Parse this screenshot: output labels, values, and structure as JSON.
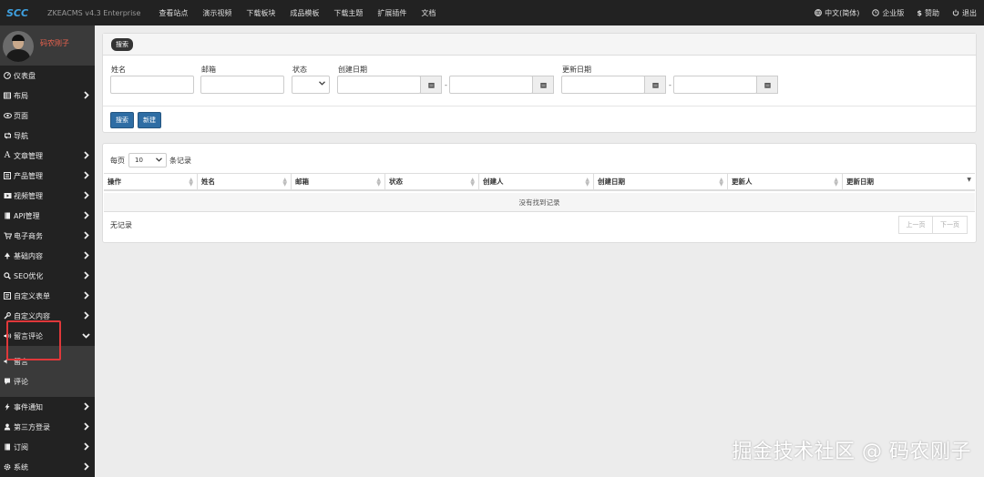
{
  "header": {
    "logo": "ZKEACMS-logo",
    "brand": "ZKEACMS v4.3 Enterprise",
    "nav": [
      "查看站点",
      "演示视频",
      "下载板块",
      "成品模板",
      "下载主题",
      "扩展插件",
      "文档"
    ],
    "right": {
      "language": "中文(简体)",
      "edition": "企业版",
      "sponsor": "赞助",
      "logout": "退出"
    }
  },
  "sidebar": {
    "username": "码农刚子",
    "items": [
      {
        "label": "仪表盘",
        "icon": "dashboard-icon"
      },
      {
        "label": "布局",
        "icon": "table-icon"
      },
      {
        "label": "页面",
        "icon": "eye-icon"
      },
      {
        "label": "导航",
        "icon": "retweet-icon"
      },
      {
        "label": "文章管理",
        "icon": "font-icon"
      },
      {
        "label": "产品管理",
        "icon": "list-icon"
      },
      {
        "label": "视频管理",
        "icon": "video-icon"
      },
      {
        "label": "API管理",
        "icon": "book-icon"
      },
      {
        "label": "电子商务",
        "icon": "cart-icon"
      },
      {
        "label": "基础内容",
        "icon": "tree-icon"
      },
      {
        "label": "SEO优化",
        "icon": "search-icon"
      },
      {
        "label": "自定义表单",
        "icon": "form-icon"
      },
      {
        "label": "自定义内容",
        "icon": "wrench-icon"
      },
      {
        "label": "留言评论",
        "icon": "volume-icon"
      }
    ],
    "sub_items": [
      {
        "label": "留言",
        "icon": "volume-icon"
      },
      {
        "label": "评论",
        "icon": "comment-icon"
      }
    ],
    "items_after": [
      {
        "label": "事件通知",
        "icon": "flash-icon"
      },
      {
        "label": "第三方登录",
        "icon": "user-icon"
      },
      {
        "label": "订阅",
        "icon": "book-icon"
      },
      {
        "label": "系统",
        "icon": "cog-icon"
      }
    ]
  },
  "search": {
    "title": "搜索",
    "fields": {
      "name_label": "姓名",
      "email_label": "邮箱",
      "status_label": "状态",
      "created_label": "创建日期",
      "updated_label": "更新日期",
      "date_sep": "-"
    },
    "search_button": "搜索",
    "new_button": "新建"
  },
  "table": {
    "per_page_prefix": "每页",
    "per_page_value": "10",
    "per_page_suffix": "条记录",
    "columns": [
      "操作",
      "姓名",
      "邮箱",
      "状态",
      "创建人",
      "创建日期",
      "更新人",
      "更新日期"
    ],
    "empty_message": "没有找到记录",
    "no_records": "无记录",
    "prev": "上一页",
    "next": "下一页"
  },
  "watermark": "掘金技术社区 @ 码农刚子",
  "colors": {
    "topbar": "#222222",
    "sidebar": "#222222",
    "primary_button": "#2e6da4",
    "username": "#e8624e",
    "highlight": "#e0383a"
  }
}
